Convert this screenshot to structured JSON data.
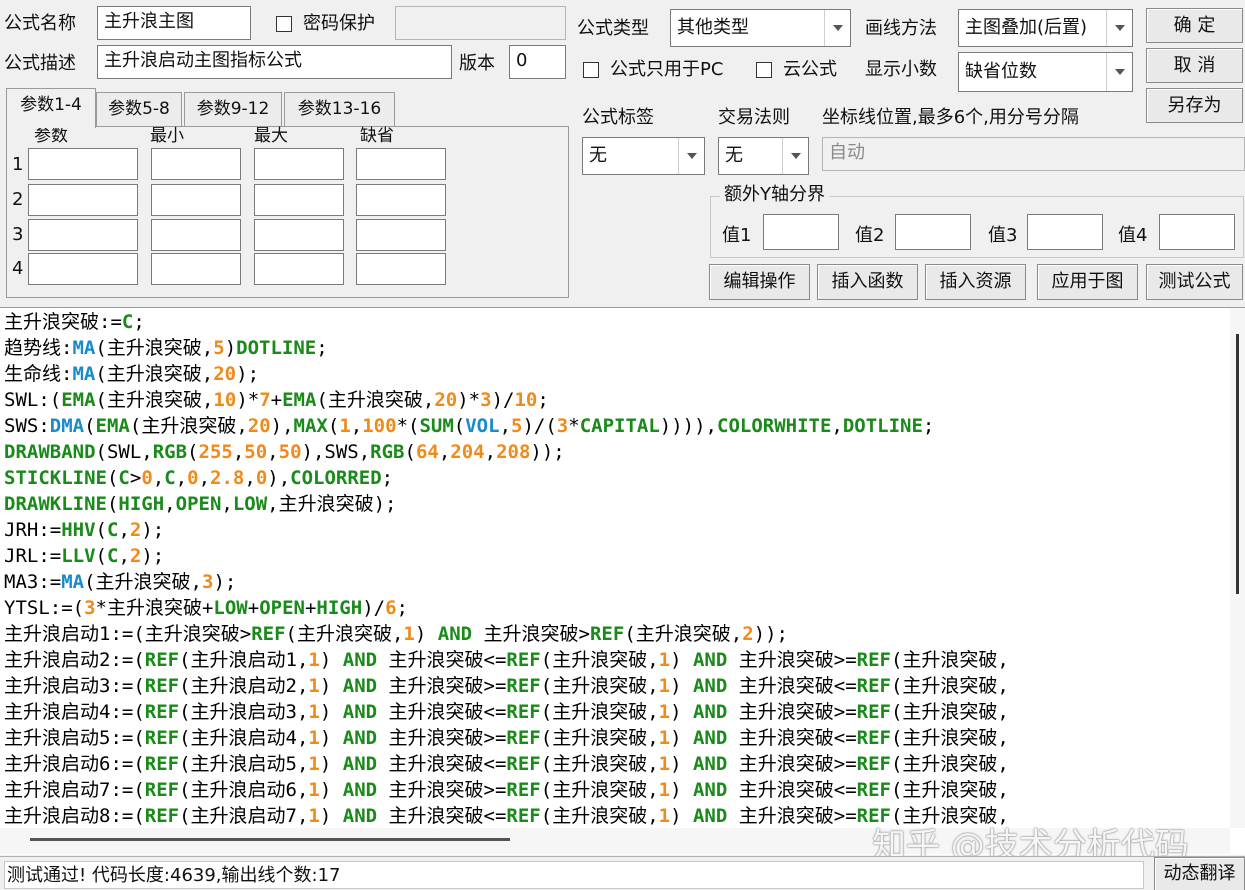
{
  "form": {
    "name_label": "公式名称",
    "name_value": "主升浪主图",
    "password_label": "密码保护",
    "password_value": "",
    "desc_label": "公式描述",
    "desc_value": "主升浪启动主图指标公式",
    "version_label": "版本",
    "version_value": "0",
    "type_label": "公式类型",
    "type_value": "其他类型",
    "draw_label": "画线方法",
    "draw_value": "主图叠加(后置)",
    "pc_only_label": "公式只用于PC",
    "cloud_label": "云公式",
    "decimals_label": "显示小数",
    "decimals_value": "缺省位数",
    "tag_label": "公式标签",
    "tag_value": "无",
    "trade_rule_label": "交易法则",
    "trade_rule_value": "无",
    "axis_label": "坐标线位置,最多6个,用分号分隔",
    "axis_value": "自动",
    "extra_y_label": "额外Y轴分界",
    "values": [
      {
        "label": "值1",
        "value": ""
      },
      {
        "label": "值2",
        "value": ""
      },
      {
        "label": "值3",
        "value": ""
      },
      {
        "label": "值4",
        "value": ""
      }
    ]
  },
  "buttons": {
    "ok": "确 定",
    "cancel": "取 消",
    "save_as": "另存为",
    "edit_ops": "编辑操作",
    "insert_func": "插入函数",
    "insert_res": "插入资源",
    "apply_chart": "应用于图",
    "test_formula": "测试公式",
    "dynamic_translate": "动态翻译"
  },
  "tabs": [
    "参数1-4",
    "参数5-8",
    "参数9-12",
    "参数13-16"
  ],
  "params": {
    "headers": [
      "参数",
      "最小",
      "最大",
      "缺省"
    ],
    "rows": [
      "1",
      "2",
      "3",
      "4"
    ]
  },
  "code": [
    [
      [
        "t",
        "主升浪突破:="
      ],
      [
        "k",
        "C"
      ],
      [
        "t",
        ";"
      ]
    ],
    [
      [
        "t",
        "趋势线:"
      ],
      [
        "f",
        "MA"
      ],
      [
        "t",
        "(主升浪突破,"
      ],
      [
        "n",
        "5"
      ],
      [
        "t",
        ")"
      ],
      [
        "k",
        "DOTLINE"
      ],
      [
        "t",
        ";"
      ]
    ],
    [
      [
        "t",
        "生命线:"
      ],
      [
        "f",
        "MA"
      ],
      [
        "t",
        "(主升浪突破,"
      ],
      [
        "n",
        "20"
      ],
      [
        "t",
        ");"
      ]
    ],
    [
      [
        "t",
        "SWL:("
      ],
      [
        "k",
        "EMA"
      ],
      [
        "t",
        "(主升浪突破,"
      ],
      [
        "n",
        "10"
      ],
      [
        "t",
        ")*"
      ],
      [
        "n",
        "7"
      ],
      [
        "t",
        "+"
      ],
      [
        "k",
        "EMA"
      ],
      [
        "t",
        "(主升浪突破,"
      ],
      [
        "n",
        "20"
      ],
      [
        "t",
        ")*"
      ],
      [
        "n",
        "3"
      ],
      [
        "t",
        ")/"
      ],
      [
        "n",
        "10"
      ],
      [
        "t",
        ";"
      ]
    ],
    [
      [
        "t",
        "SWS:"
      ],
      [
        "f",
        "DMA"
      ],
      [
        "t",
        "("
      ],
      [
        "k",
        "EMA"
      ],
      [
        "t",
        "(主升浪突破,"
      ],
      [
        "n",
        "20"
      ],
      [
        "t",
        "),"
      ],
      [
        "k",
        "MAX"
      ],
      [
        "t",
        "("
      ],
      [
        "n",
        "1"
      ],
      [
        "t",
        ","
      ],
      [
        "n",
        "100"
      ],
      [
        "t",
        "*("
      ],
      [
        "k",
        "SUM"
      ],
      [
        "t",
        "("
      ],
      [
        "f",
        "VOL"
      ],
      [
        "t",
        ","
      ],
      [
        "n",
        "5"
      ],
      [
        "t",
        ")/("
      ],
      [
        "n",
        "3"
      ],
      [
        "t",
        "*"
      ],
      [
        "k",
        "CAPITAL"
      ],
      [
        "t",
        "))))"
      ],
      [
        "t",
        ","
      ],
      [
        "k",
        "COLORWHITE"
      ],
      [
        "t",
        ","
      ],
      [
        "k",
        "DOTLINE"
      ],
      [
        "t",
        ";"
      ]
    ],
    [
      [
        "k",
        "DRAWBAND"
      ],
      [
        "t",
        "(SWL,"
      ],
      [
        "k",
        "RGB"
      ],
      [
        "t",
        "("
      ],
      [
        "n",
        "255"
      ],
      [
        "t",
        ","
      ],
      [
        "n",
        "50"
      ],
      [
        "t",
        ","
      ],
      [
        "n",
        "50"
      ],
      [
        "t",
        "),SWS,"
      ],
      [
        "k",
        "RGB"
      ],
      [
        "t",
        "("
      ],
      [
        "n",
        "64"
      ],
      [
        "t",
        ","
      ],
      [
        "n",
        "204"
      ],
      [
        "t",
        ","
      ],
      [
        "n",
        "208"
      ],
      [
        "t",
        "));"
      ]
    ],
    [
      [
        "k",
        "STICKLINE"
      ],
      [
        "t",
        "("
      ],
      [
        "k",
        "C"
      ],
      [
        "t",
        ">"
      ],
      [
        "n",
        "0"
      ],
      [
        "t",
        ","
      ],
      [
        "k",
        "C"
      ],
      [
        "t",
        ","
      ],
      [
        "n",
        "0"
      ],
      [
        "t",
        ","
      ],
      [
        "n",
        "2.8"
      ],
      [
        "t",
        ","
      ],
      [
        "n",
        "0"
      ],
      [
        "t",
        "),"
      ],
      [
        "k",
        "COLORRED"
      ],
      [
        "t",
        ";"
      ]
    ],
    [
      [
        "k",
        "DRAWKLINE"
      ],
      [
        "t",
        "("
      ],
      [
        "k",
        "HIGH"
      ],
      [
        "t",
        ","
      ],
      [
        "k",
        "OPEN"
      ],
      [
        "t",
        ","
      ],
      [
        "k",
        "LOW"
      ],
      [
        "t",
        ",主升浪突破);"
      ]
    ],
    [
      [
        "t",
        "JRH:="
      ],
      [
        "k",
        "HHV"
      ],
      [
        "t",
        "("
      ],
      [
        "k",
        "C"
      ],
      [
        "t",
        ","
      ],
      [
        "n",
        "2"
      ],
      [
        "t",
        ");"
      ]
    ],
    [
      [
        "t",
        "JRL:="
      ],
      [
        "k",
        "LLV"
      ],
      [
        "t",
        "("
      ],
      [
        "k",
        "C"
      ],
      [
        "t",
        ","
      ],
      [
        "n",
        "2"
      ],
      [
        "t",
        ");"
      ]
    ],
    [
      [
        "t",
        "MA3:="
      ],
      [
        "f",
        "MA"
      ],
      [
        "t",
        "(主升浪突破,"
      ],
      [
        "n",
        "3"
      ],
      [
        "t",
        ");"
      ]
    ],
    [
      [
        "t",
        "YTSL:=("
      ],
      [
        "n",
        "3"
      ],
      [
        "t",
        "*主升浪突破+"
      ],
      [
        "k",
        "LOW"
      ],
      [
        "t",
        "+"
      ],
      [
        "k",
        "OPEN"
      ],
      [
        "t",
        "+"
      ],
      [
        "k",
        "HIGH"
      ],
      [
        "t",
        ")/"
      ],
      [
        "n",
        "6"
      ],
      [
        "t",
        ";"
      ]
    ],
    [
      [
        "t",
        "主升浪启动1:=(主升浪突破>"
      ],
      [
        "k",
        "REF"
      ],
      [
        "t",
        "(主升浪突破,"
      ],
      [
        "n",
        "1"
      ],
      [
        "t",
        ") "
      ],
      [
        "k",
        "AND"
      ],
      [
        "t",
        " 主升浪突破>"
      ],
      [
        "k",
        "REF"
      ],
      [
        "t",
        "(主升浪突破,"
      ],
      [
        "n",
        "2"
      ],
      [
        "t",
        "));"
      ]
    ],
    [
      [
        "t",
        "主升浪启动2:=("
      ],
      [
        "k",
        "REF"
      ],
      [
        "t",
        "(主升浪启动1,"
      ],
      [
        "n",
        "1"
      ],
      [
        "t",
        ") "
      ],
      [
        "k",
        "AND"
      ],
      [
        "t",
        " 主升浪突破<="
      ],
      [
        "k",
        "REF"
      ],
      [
        "t",
        "(主升浪突破,"
      ],
      [
        "n",
        "1"
      ],
      [
        "t",
        ") "
      ],
      [
        "k",
        "AND"
      ],
      [
        "t",
        " 主升浪突破>="
      ],
      [
        "k",
        "REF"
      ],
      [
        "t",
        "(主升浪突破,"
      ]
    ],
    [
      [
        "t",
        "主升浪启动3:=("
      ],
      [
        "k",
        "REF"
      ],
      [
        "t",
        "(主升浪启动2,"
      ],
      [
        "n",
        "1"
      ],
      [
        "t",
        ") "
      ],
      [
        "k",
        "AND"
      ],
      [
        "t",
        " 主升浪突破>="
      ],
      [
        "k",
        "REF"
      ],
      [
        "t",
        "(主升浪突破,"
      ],
      [
        "n",
        "1"
      ],
      [
        "t",
        ") "
      ],
      [
        "k",
        "AND"
      ],
      [
        "t",
        " 主升浪突破<="
      ],
      [
        "k",
        "REF"
      ],
      [
        "t",
        "(主升浪突破,"
      ]
    ],
    [
      [
        "t",
        "主升浪启动4:=("
      ],
      [
        "k",
        "REF"
      ],
      [
        "t",
        "(主升浪启动3,"
      ],
      [
        "n",
        "1"
      ],
      [
        "t",
        ") "
      ],
      [
        "k",
        "AND"
      ],
      [
        "t",
        " 主升浪突破<="
      ],
      [
        "k",
        "REF"
      ],
      [
        "t",
        "(主升浪突破,"
      ],
      [
        "n",
        "1"
      ],
      [
        "t",
        ") "
      ],
      [
        "k",
        "AND"
      ],
      [
        "t",
        " 主升浪突破>="
      ],
      [
        "k",
        "REF"
      ],
      [
        "t",
        "(主升浪突破,"
      ]
    ],
    [
      [
        "t",
        "主升浪启动5:=("
      ],
      [
        "k",
        "REF"
      ],
      [
        "t",
        "(主升浪启动4,"
      ],
      [
        "n",
        "1"
      ],
      [
        "t",
        ") "
      ],
      [
        "k",
        "AND"
      ],
      [
        "t",
        " 主升浪突破>="
      ],
      [
        "k",
        "REF"
      ],
      [
        "t",
        "(主升浪突破,"
      ],
      [
        "n",
        "1"
      ],
      [
        "t",
        ") "
      ],
      [
        "k",
        "AND"
      ],
      [
        "t",
        " 主升浪突破<="
      ],
      [
        "k",
        "REF"
      ],
      [
        "t",
        "(主升浪突破,"
      ]
    ],
    [
      [
        "t",
        "主升浪启动6:=("
      ],
      [
        "k",
        "REF"
      ],
      [
        "t",
        "(主升浪启动5,"
      ],
      [
        "n",
        "1"
      ],
      [
        "t",
        ") "
      ],
      [
        "k",
        "AND"
      ],
      [
        "t",
        " 主升浪突破<="
      ],
      [
        "k",
        "REF"
      ],
      [
        "t",
        "(主升浪突破,"
      ],
      [
        "n",
        "1"
      ],
      [
        "t",
        ") "
      ],
      [
        "k",
        "AND"
      ],
      [
        "t",
        " 主升浪突破>="
      ],
      [
        "k",
        "REF"
      ],
      [
        "t",
        "(主升浪突破,"
      ]
    ],
    [
      [
        "t",
        "主升浪启动7:=("
      ],
      [
        "k",
        "REF"
      ],
      [
        "t",
        "(主升浪启动6,"
      ],
      [
        "n",
        "1"
      ],
      [
        "t",
        ") "
      ],
      [
        "k",
        "AND"
      ],
      [
        "t",
        " 主升浪突破>="
      ],
      [
        "k",
        "REF"
      ],
      [
        "t",
        "(主升浪突破,"
      ],
      [
        "n",
        "1"
      ],
      [
        "t",
        ") "
      ],
      [
        "k",
        "AND"
      ],
      [
        "t",
        " 主升浪突破<="
      ],
      [
        "k",
        "REF"
      ],
      [
        "t",
        "(主升浪突破,"
      ]
    ],
    [
      [
        "t",
        "主升浪启动8:=("
      ],
      [
        "k",
        "REF"
      ],
      [
        "t",
        "(主升浪启动7,"
      ],
      [
        "n",
        "1"
      ],
      [
        "t",
        ") "
      ],
      [
        "k",
        "AND"
      ],
      [
        "t",
        " 主升浪突破<="
      ],
      [
        "k",
        "REF"
      ],
      [
        "t",
        "(主升浪突破,"
      ],
      [
        "n",
        "1"
      ],
      [
        "t",
        ") "
      ],
      [
        "k",
        "AND"
      ],
      [
        "t",
        " 主升浪突破>="
      ],
      [
        "k",
        "REF"
      ],
      [
        "t",
        "(主升浪突破,"
      ]
    ]
  ],
  "status": "测试通过! 代码长度:4639,输出线个数:17",
  "watermark": "知乎 @技术分析代码",
  "colors": {
    "keyword": "#1a8a1a",
    "function": "#1a8aca",
    "number": "#f08a1a"
  }
}
